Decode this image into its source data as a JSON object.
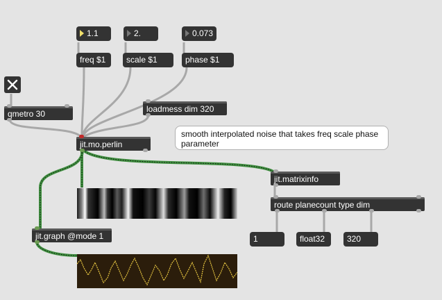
{
  "patcher": {
    "number_boxes": [
      {
        "value": "1.1"
      },
      {
        "value": "2."
      },
      {
        "value": "0.073"
      }
    ],
    "messages": {
      "freq": "freq $1",
      "scale": "scale $1",
      "phase": "phase $1",
      "loadmess": "loadmess dim 320",
      "out_planecount": "1",
      "out_type": "float32",
      "out_dim": "320"
    },
    "objects": {
      "qmetro": "qmetro 30",
      "perlin": "jit.mo.perlin",
      "matrixinfo": "jit.matrixinfo",
      "route": "route planecount type dim",
      "graph": "jit.graph @mode 1"
    },
    "comment": "smooth interpolated noise that takes freq scale phase parameter",
    "toggle_state": true,
    "colors": {
      "background": "#e4e4e4",
      "box": "#333333",
      "patch_cord": "#a8a8a8",
      "matrix_cord": "#3f8f3f",
      "number_active": "#f1e06b",
      "graph_line": "#e7c641",
      "graph_bg": "#2b1d0b",
      "inlet_hot": "#c22a2a"
    }
  }
}
